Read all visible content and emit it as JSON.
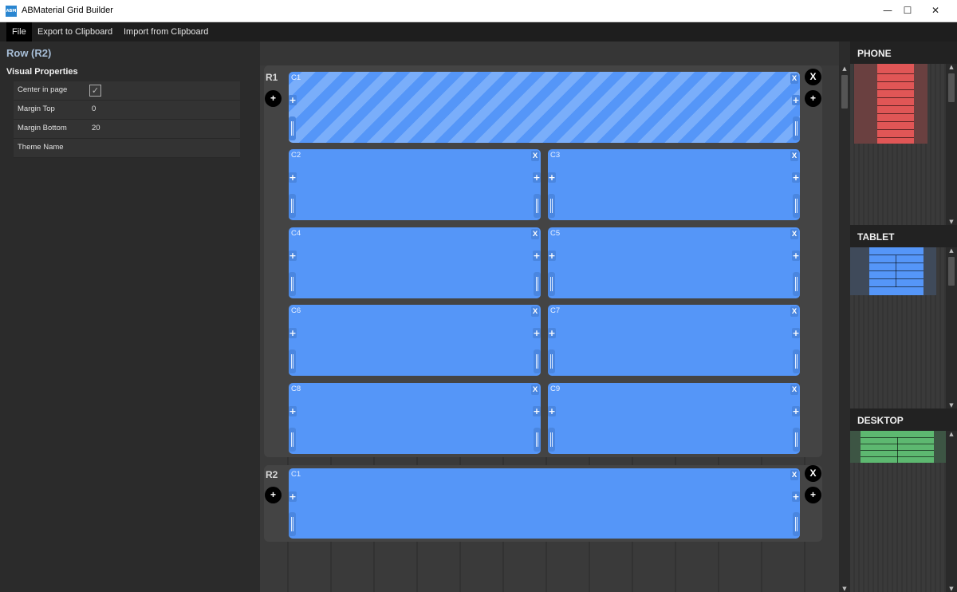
{
  "window": {
    "title": "ABMaterial Grid Builder",
    "icon_text": "ABM",
    "minimize": "—",
    "maximize": "☐",
    "close": "✕"
  },
  "menu": {
    "file": "File",
    "export": "Export to Clipboard",
    "import": "Import from Clipboard"
  },
  "properties": {
    "title": "Row (R2)",
    "section": "Visual Properties",
    "center_label": "Center in page",
    "center_checked": "✓",
    "margin_top_label": "Margin Top",
    "margin_top_value": "0",
    "margin_bottom_label": "Margin Bottom",
    "margin_bottom_value": "20",
    "theme_label": "Theme Name",
    "theme_value": ""
  },
  "builder": {
    "remove_symbol": "X",
    "add_symbol": "+",
    "rows": [
      {
        "label": "R1",
        "cells": [
          "C1",
          "C2",
          "C3",
          "C4",
          "C5",
          "C6",
          "C7",
          "C8",
          "C9"
        ]
      },
      {
        "label": "R2",
        "cells": [
          "C1"
        ]
      }
    ]
  },
  "preview": {
    "phone": "PHONE",
    "tablet": "TABLET",
    "desktop": "DESKTOP",
    "colors": {
      "phone": "#e05656",
      "tablet": "#5596f8",
      "desktop": "#5db870"
    }
  },
  "colors": {
    "column": "#5596f8",
    "background": "#2b2b2b",
    "panel_title": "#a8bfd8"
  }
}
